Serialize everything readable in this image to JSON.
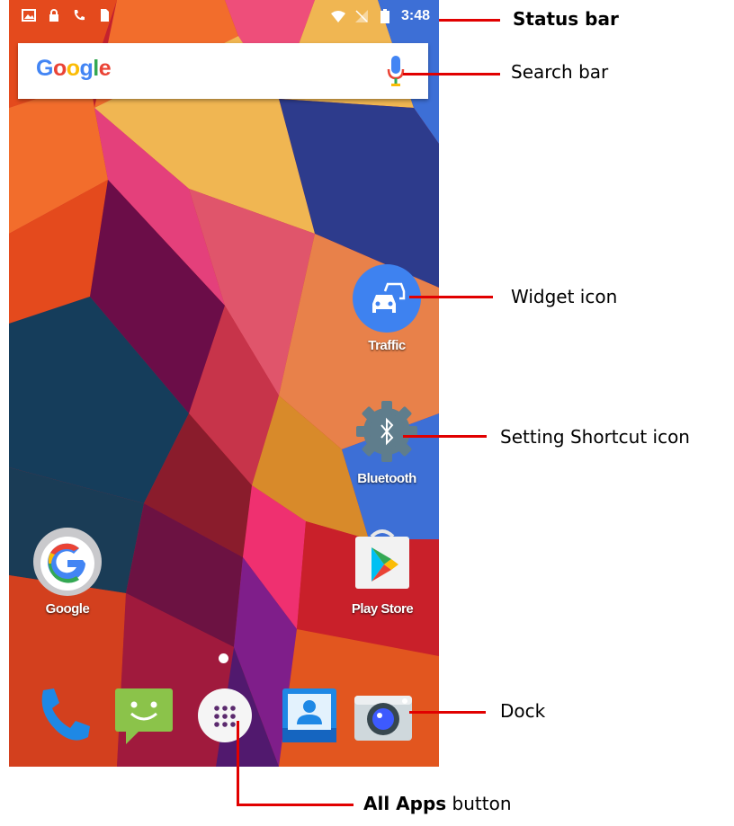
{
  "status_bar": {
    "time": "3:48",
    "left_icons": [
      "gallery-icon",
      "lock-icon",
      "phone-icon",
      "sim-icon"
    ],
    "right_icons": [
      "wifi-icon",
      "no-signal-icon",
      "battery-icon"
    ]
  },
  "search_bar": {
    "logo_letters": [
      {
        "char": "G",
        "color": "#4285F4"
      },
      {
        "char": "o",
        "color": "#EA4335"
      },
      {
        "char": "o",
        "color": "#FBBC05"
      },
      {
        "char": "g",
        "color": "#4285F4"
      },
      {
        "char": "l",
        "color": "#34A853"
      },
      {
        "char": "e",
        "color": "#EA4335"
      }
    ],
    "mic_icon": "mic-icon"
  },
  "home_icons": [
    {
      "label": "Traffic",
      "icon": "traffic-car-icon",
      "color": "#3E82F0"
    },
    {
      "label": "Bluetooth",
      "icon": "bluetooth-settings-gear-icon",
      "color": "#5F7D8C"
    },
    {
      "label": "Google",
      "icon": "google-g-icon"
    },
    {
      "label": "Play Store",
      "icon": "play-store-icon"
    }
  ],
  "dock": [
    {
      "name": "phone",
      "icon": "phone-icon"
    },
    {
      "name": "messaging",
      "icon": "messaging-icon"
    },
    {
      "name": "all-apps",
      "icon": "all-apps-icon"
    },
    {
      "name": "contacts",
      "icon": "contacts-icon"
    },
    {
      "name": "camera",
      "icon": "camera-icon"
    }
  ],
  "callouts": {
    "status_bar": "Status bar",
    "search_bar": "Search bar",
    "widget_icon": "Widget icon",
    "setting_shortcut": "Setting Shortcut icon",
    "dock": "Dock",
    "all_apps_bold": "All Apps",
    "all_apps_rest": " button"
  },
  "colors": {
    "callout_line": "#E10000",
    "google_blue": "#4285F4",
    "google_red": "#EA4335",
    "google_yellow": "#FBBC05",
    "google_green": "#34A853"
  }
}
